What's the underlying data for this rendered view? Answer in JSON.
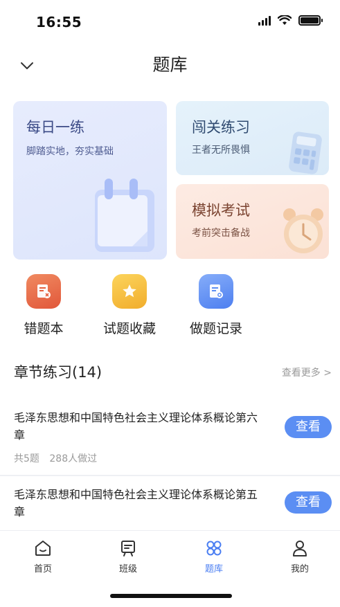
{
  "status_bar": {
    "time": "16:55"
  },
  "header": {
    "title": "题库",
    "back_icon": "chevron-down-icon"
  },
  "cards": {
    "daily": {
      "title": "每日一练",
      "subtitle": "脚踏实地，夯实基础",
      "icon": "calendar-icon"
    },
    "level": {
      "title": "闯关练习",
      "subtitle": "王者无所畏惧",
      "icon": "calculator-icon"
    },
    "exam": {
      "title": "模拟考试",
      "subtitle": "考前突击备战",
      "icon": "alarm-clock-icon"
    }
  },
  "quick_actions": [
    {
      "label": "错题本",
      "icon": "wrong-book-icon",
      "color": "#e6603f"
    },
    {
      "label": "试题收藏",
      "icon": "star-icon",
      "color": "#f4b835"
    },
    {
      "label": "做题记录",
      "icon": "record-icon",
      "color": "#5b8ef3"
    }
  ],
  "section": {
    "title": "章节练习(14)",
    "see_more": "查看更多 >"
  },
  "chapters": [
    {
      "title": "毛泽东思想和中国特色社会主义理论体系概论第六章",
      "count": "共5题",
      "done": "288人做过",
      "button": "查看"
    },
    {
      "title": "毛泽东思想和中国特色社会主义理论体系概论第五章",
      "button": "查看"
    }
  ],
  "tabs": [
    {
      "label": "首页",
      "icon": "home-icon",
      "active": false
    },
    {
      "label": "班级",
      "icon": "class-icon",
      "active": false
    },
    {
      "label": "题库",
      "icon": "question-bank-icon",
      "active": true
    },
    {
      "label": "我的",
      "icon": "user-icon",
      "active": false
    }
  ],
  "colors": {
    "accent": "#5b8ef3",
    "active_tab": "#4a7ef2"
  }
}
